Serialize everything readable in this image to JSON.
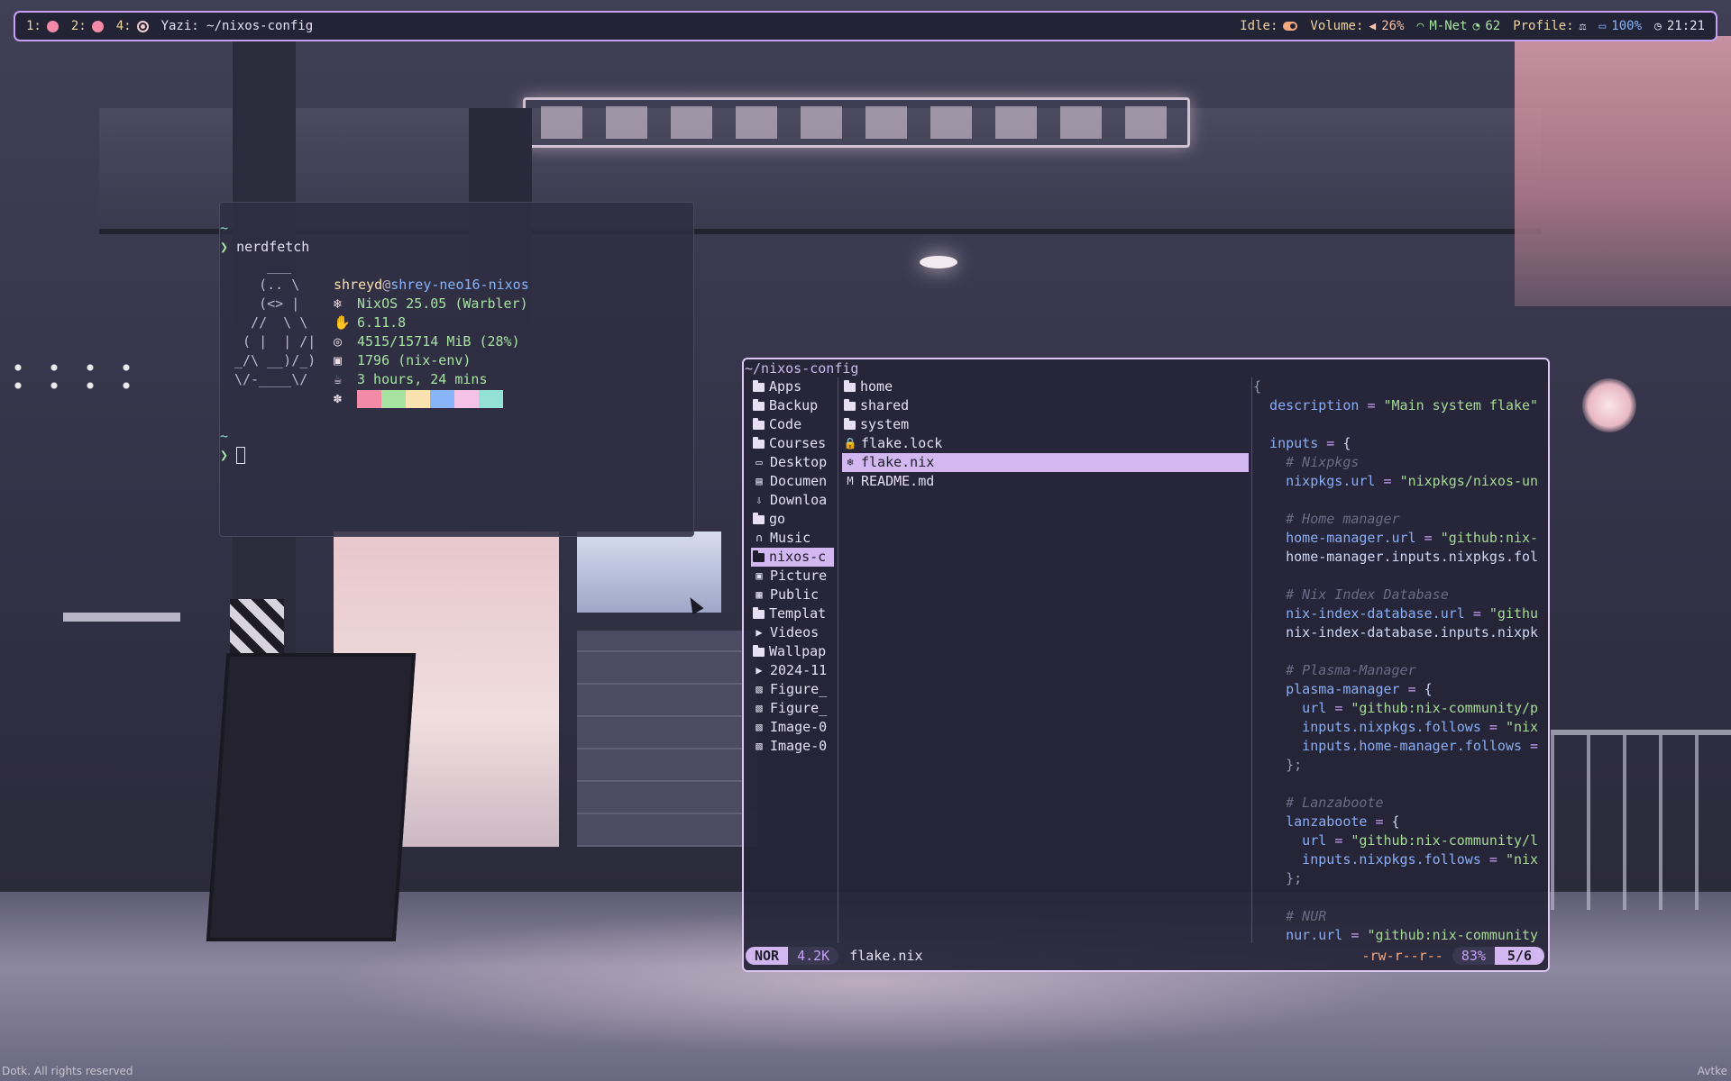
{
  "topbar": {
    "workspaces": [
      {
        "label": "1:",
        "icon": "circle-filled-icon"
      },
      {
        "label": "2:",
        "icon": "circle-filled-icon"
      },
      {
        "label": "4:",
        "icon": "circle-target-icon"
      }
    ],
    "window_title": "Yazi: ~/nixos-config",
    "idle_label": "Idle:",
    "volume_label": "Volume:",
    "volume_value": "26%",
    "network_name": "M-Net",
    "network_signal": "62",
    "profile_label": "Profile:",
    "battery_value": "100%",
    "clock": "21:21",
    "accent": "#c6a0f6"
  },
  "terminal": {
    "prompt_dir": "~",
    "prompt_symbol": "❯",
    "command": "nerdfetch",
    "ascii_art": [
      "    ___",
      "   (.. \\",
      "   (<> |",
      "  //  \\ \\",
      " ( |  | /|",
      "_/\\ __)/_)",
      "\\/-____\\/"
    ],
    "user": "shreyd",
    "at": "@",
    "host": "shrey-neo16-nixos",
    "info": [
      {
        "icon": "nixos-icon",
        "value": "NixOS 25.05 (Warbler)"
      },
      {
        "icon": "tux-icon",
        "value": "6.11.8"
      },
      {
        "icon": "memory-icon",
        "value": "4515/15714 MiB (28%)"
      },
      {
        "icon": "package-icon",
        "value": "1796 (nix-env)"
      },
      {
        "icon": "uptime-icon",
        "value": "3 hours, 24 mins"
      }
    ],
    "palette_icon": "palette-icon",
    "palette": [
      "#f38ba8",
      "#a6e3a1",
      "#f9e2af",
      "#89b4fa",
      "#f5c2e7",
      "#94e2d5"
    ]
  },
  "yazi": {
    "path": "~/nixos-config",
    "parent_entries": [
      {
        "name": "Apps",
        "icon": "folder-icon"
      },
      {
        "name": "Backup",
        "icon": "folder-icon"
      },
      {
        "name": "Code",
        "icon": "folder-icon"
      },
      {
        "name": "Courses",
        "icon": "folder-icon"
      },
      {
        "name": "Desktop",
        "icon": "desktop-icon"
      },
      {
        "name": "Documen",
        "icon": "documents-icon"
      },
      {
        "name": "Downloa",
        "icon": "downloads-icon"
      },
      {
        "name": "go",
        "icon": "folder-icon"
      },
      {
        "name": "Music",
        "icon": "headphones-icon"
      },
      {
        "name": "nixos-c",
        "icon": "folder-icon",
        "selected": true
      },
      {
        "name": "Picture",
        "icon": "pictures-icon"
      },
      {
        "name": "Public",
        "icon": "public-icon"
      },
      {
        "name": "Templat",
        "icon": "folder-icon"
      },
      {
        "name": "Videos",
        "icon": "video-icon"
      },
      {
        "name": "Wallpap",
        "icon": "folder-icon"
      },
      {
        "name": "2024-11",
        "icon": "play-circle-icon"
      },
      {
        "name": "Figure_",
        "icon": "image-icon"
      },
      {
        "name": "Figure_",
        "icon": "image-icon"
      },
      {
        "name": "Image-0",
        "icon": "image-icon"
      },
      {
        "name": "Image-0",
        "icon": "image-icon"
      }
    ],
    "current_entries": [
      {
        "name": "home",
        "icon": "folder-icon"
      },
      {
        "name": "shared",
        "icon": "folder-icon"
      },
      {
        "name": "system",
        "icon": "folder-icon"
      },
      {
        "name": "flake.lock",
        "icon": "lock-icon"
      },
      {
        "name": "flake.nix",
        "icon": "nix-gear-icon",
        "selected": true
      },
      {
        "name": "README.md",
        "icon": "markdown-icon"
      }
    ],
    "preview_lines": [
      "{",
      "  description = \"Main system flake\"",
      "",
      "  inputs = {",
      "    # Nixpkgs",
      "    nixpkgs.url = \"nixpkgs/nixos-un",
      "",
      "    # Home manager",
      "    home-manager.url = \"github:nix-",
      "    home-manager.inputs.nixpkgs.fol",
      "",
      "    # Nix Index Database",
      "    nix-index-database.url = \"githu",
      "    nix-index-database.inputs.nixpk",
      "",
      "    # Plasma-Manager",
      "    plasma-manager = {",
      "      url = \"github:nix-community/p",
      "      inputs.nixpkgs.follows = \"nix",
      "      inputs.home-manager.follows =",
      "    };",
      "",
      "    # Lanzaboote",
      "    lanzaboote = {",
      "      url = \"github:nix-community/l",
      "      inputs.nixpkgs.follows = \"nix",
      "    };",
      "",
      "    # NUR",
      "    nur.url = \"github:nix-community"
    ],
    "status": {
      "mode": "NOR",
      "size": "4.2K",
      "filename": "flake.nix",
      "permissions": "-rw-r--r--",
      "percent": "83%",
      "position": "5/6"
    }
  },
  "wallpaper": {
    "credit_left": "Dotk. All rights reserved",
    "credit_right": "Avtke"
  }
}
